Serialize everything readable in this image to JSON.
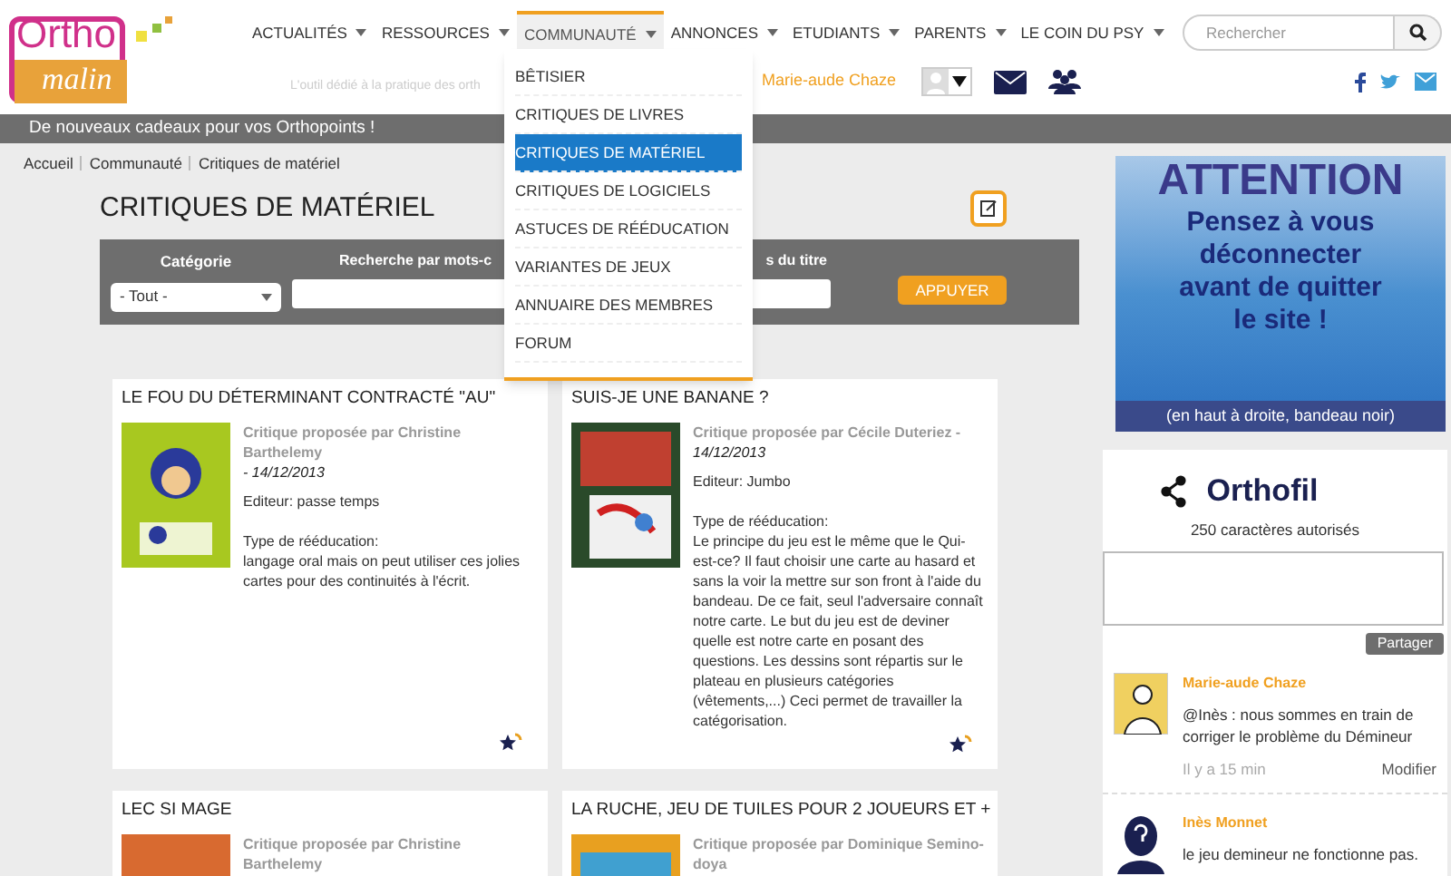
{
  "logo": {
    "line1": "Ortho",
    "line2": "malin"
  },
  "nav": [
    {
      "label": "ACTUALITÉS",
      "selected": false
    },
    {
      "label": "RESSOURCES",
      "selected": false
    },
    {
      "label": "COMMUNAUTÉ",
      "selected": true
    },
    {
      "label": "ANNONCES",
      "selected": false
    },
    {
      "label": "ETUDIANTS",
      "selected": false
    },
    {
      "label": "PARENTS",
      "selected": false
    },
    {
      "label": "LE COIN DU PSY",
      "selected": false
    }
  ],
  "tagline": "L'outil dédié à la pratique des orth",
  "user_name": "Marie-aude Chaze",
  "search": {
    "placeholder": "Rechercher"
  },
  "dropdown": [
    {
      "label": "BÊTISIER",
      "selected": false
    },
    {
      "label": "CRITIQUES DE LIVRES",
      "selected": false
    },
    {
      "label": "CRITIQUES DE MATÉRIEL",
      "selected": true
    },
    {
      "label": "CRITIQUES DE LOGICIELS",
      "selected": false
    },
    {
      "label": "ASTUCES DE RÉÉDUCATION",
      "selected": false
    },
    {
      "label": "VARIANTES DE JEUX",
      "selected": false
    },
    {
      "label": "ANNUAIRE DES MEMBRES",
      "selected": false
    },
    {
      "label": "FORUM",
      "selected": false
    }
  ],
  "announcement": "De nouveaux cadeaux pour vos Orthopoints !",
  "breadcrumb": [
    "Accueil",
    "Communauté",
    "Critiques de matériel"
  ],
  "page_title": "CRITIQUES DE MATÉRIEL",
  "filters": {
    "category_label": "Catégorie",
    "category_value": "- Tout -",
    "keywords_label": "Recherche par mots-c",
    "title_label": "s du titre",
    "apply": "APPUYER"
  },
  "cards": [
    {
      "title": "LE FOU DU DÉTERMINANT CONTRACTÉ \"AU\"",
      "author": "Critique proposée par Christine Barthelemy",
      "date": "- 14/12/2013",
      "publisher": "Editeur: passe temps",
      "type_label": "Type de rééducation:",
      "body": "langage oral mais on peut utiliser ces jolies cartes pour des continuités à l'écrit."
    },
    {
      "title": "SUIS-JE UNE BANANE ?",
      "author": "Critique proposée par Cécile Duteriez -",
      "date": "14/12/2013",
      "publisher": "Editeur: Jumbo",
      "type_label": "Type de rééducation:",
      "body": "Le principe du jeu est le même que le Qui-est-ce? Il faut choisir une carte au hasard et sans la voir la mettre sur son front à l'aide du bandeau. De ce fait, seul l'adversaire connaît notre carte. Le but du jeu est de deviner quelle est notre carte en posant des questions. Les dessins sont répartis sur le plateau en plusieurs catégories (vêtements,...) Ceci permet de travailler la catégorisation."
    },
    {
      "title": "LEC SI MAGE",
      "author": "Critique proposée par Christine Barthelemy"
    },
    {
      "title": "LA RUCHE, JEU DE TUILES POUR 2 JOUEURS ET +",
      "author": "Critique proposée par Dominique Semino-doya"
    }
  ],
  "banner": {
    "heading": "ATTENTION",
    "lines": [
      "Pensez à vous",
      "déconnecter",
      "avant de quitter",
      "le site !"
    ],
    "footer": "(en haut à droite, bandeau noir)"
  },
  "orthofil": {
    "title": "Orthofil",
    "hint": "250 caractères autorisés",
    "share": "Partager"
  },
  "comments": [
    {
      "author": "Marie-aude Chaze",
      "text": "@Inès : nous sommes en train de corriger le problème du Démineur",
      "time": "Il y a 15 min",
      "action": "Modifier"
    },
    {
      "kind": "unknown",
      "author": "Inès Monnet",
      "text": "le jeu demineur ne fonctionne pas."
    }
  ]
}
